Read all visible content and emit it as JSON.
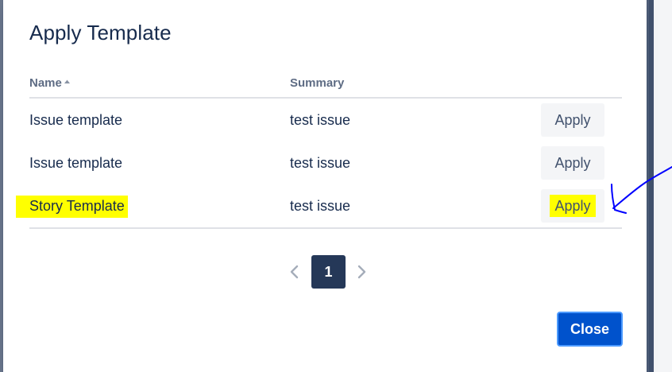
{
  "modal": {
    "title": "Apply Template"
  },
  "table": {
    "headers": {
      "name": "Name",
      "summary": "Summary"
    },
    "rows": [
      {
        "name": "Issue template",
        "summary": "test issue",
        "action": "Apply",
        "highlighted": false
      },
      {
        "name": "Issue template",
        "summary": "test issue",
        "action": "Apply",
        "highlighted": false
      },
      {
        "name": "Story Template",
        "summary": "test issue",
        "action": "Apply",
        "highlighted": true
      }
    ]
  },
  "pagination": {
    "current_page": "1",
    "prev_icon": "chevron-left-icon",
    "next_icon": "chevron-right-icon"
  },
  "footer": {
    "close_label": "Close"
  },
  "colors": {
    "primary": "#0052cc",
    "page_active": "#253858",
    "highlight": "#ffff00",
    "annotation": "#0000ff"
  }
}
